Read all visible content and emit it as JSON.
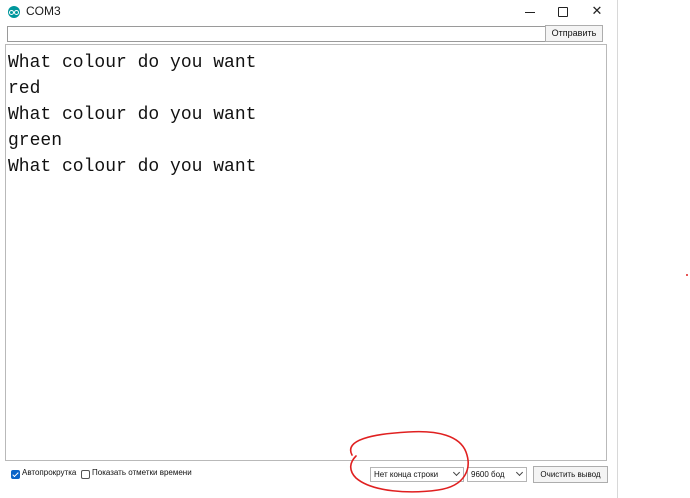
{
  "window": {
    "title": "COM3",
    "app_icon": "arduino-logo-icon",
    "controls": [
      "minimize-icon",
      "maximize-icon",
      "close-icon"
    ]
  },
  "send_row": {
    "input_value": "",
    "input_placeholder": "",
    "send_label": "Отправить"
  },
  "output": {
    "lines": [
      "What colour do you want",
      "red",
      "What colour do you want",
      "green",
      "What colour do you want"
    ]
  },
  "bottom_bar": {
    "autoscroll": {
      "label": "Автопрокрутка",
      "checked": true
    },
    "timestamps": {
      "label": "Показать отметки времени",
      "checked": false
    },
    "line_ending_selected": "Нет конца строки",
    "baud_selected": "9600 бод",
    "clear_label": "Очистить вывод"
  },
  "colors": {
    "accent": "#0a64c8",
    "annotation": "#e02020",
    "app_icon": "#00979c"
  }
}
